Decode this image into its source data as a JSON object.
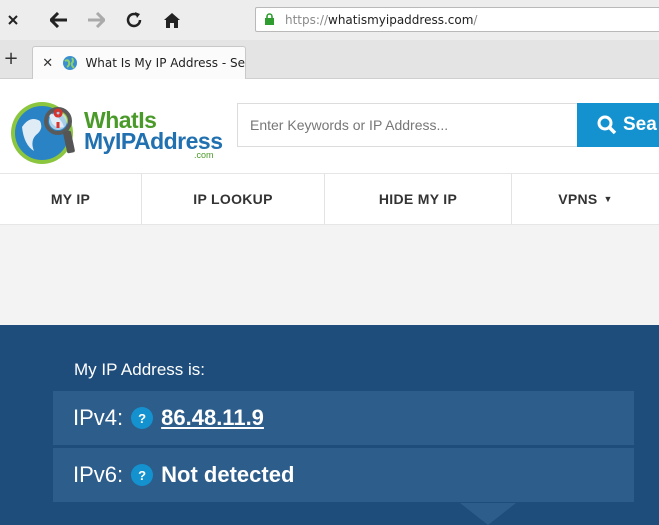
{
  "browser": {
    "url": {
      "protocol": "https://",
      "host": "whatismyipaddress.com",
      "path": "/"
    },
    "tab": {
      "title": "What Is My IP Address - Se"
    }
  },
  "header": {
    "logo": {
      "line1": "WhatIs",
      "line2": "MyIPAddress",
      "suffix": ".com"
    },
    "search": {
      "placeholder": "Enter Keywords or IP Address...",
      "button_label": "Sea"
    }
  },
  "nav": {
    "items": [
      {
        "label": "MY IP"
      },
      {
        "label": "IP LOOKUP"
      },
      {
        "label": "HIDE MY IP"
      },
      {
        "label": "VPNS",
        "caret": "▼"
      }
    ]
  },
  "ip_panel": {
    "title": "My IP Address is:",
    "help_glyph": "?",
    "ipv4": {
      "label": "IPv4:",
      "value": "86.48.11.9"
    },
    "ipv6": {
      "label": "IPv6:",
      "value": "Not detected"
    }
  },
  "colors": {
    "accent": "#1492d0",
    "hero_bg": "#1e4d7c",
    "row_bg": "#2d5d8b",
    "logo_green": "#4a9a2a",
    "logo_blue": "#2170b0"
  }
}
